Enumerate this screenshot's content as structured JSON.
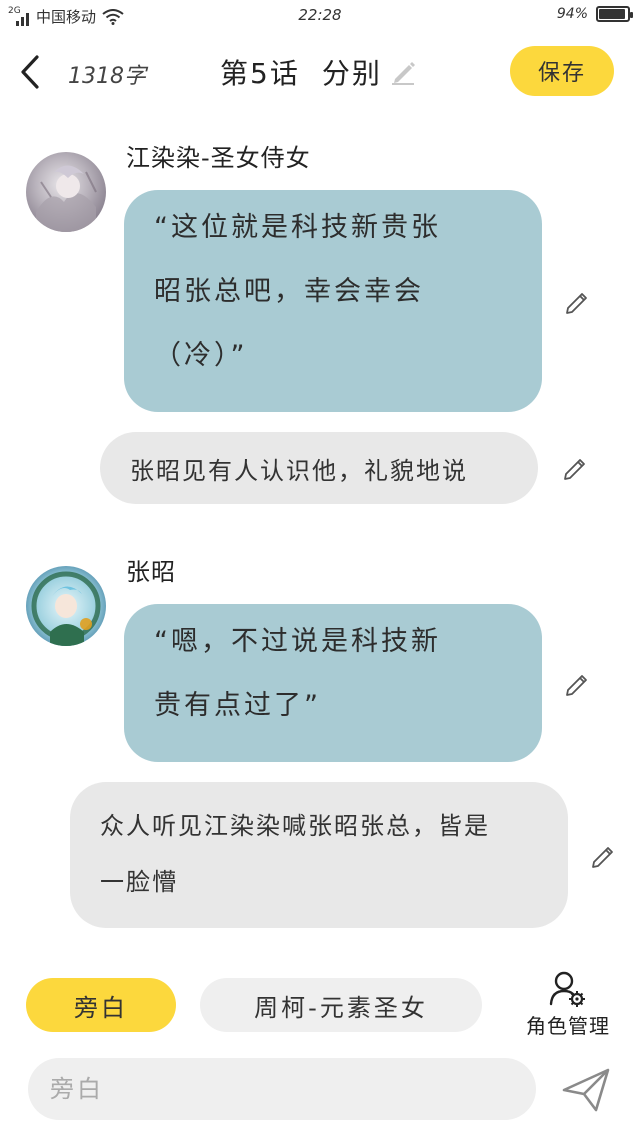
{
  "status_bar": {
    "network_type": "2G",
    "carrier": "中国移动",
    "time": "22:28",
    "battery_text": "94%",
    "battery_level": 0.94
  },
  "nav": {
    "word_count": "1318字",
    "chapter": "第5话",
    "chapter_title": "分别",
    "save_label": "保存"
  },
  "messages": [
    {
      "speaker": "江染染-圣女侍女",
      "lines": [
        "“这位就是科技新贵张",
        "昭张总吧，幸会幸会",
        "（冷）”"
      ]
    },
    {
      "narration": "张昭见有人认识他，礼貌地说"
    },
    {
      "speaker": "张昭",
      "lines": [
        "“嗯，不过说是科技新",
        "贵有点过了”"
      ]
    },
    {
      "narration_lines": [
        "众人听见江染染喊张昭张总，皆是",
        "一脸懵"
      ]
    }
  ],
  "bottom": {
    "role_narration": "旁白",
    "role_character": "周柯-元素圣女",
    "role_manage": "角色管理",
    "input_placeholder": "旁白"
  },
  "colors": {
    "accent_yellow": "#fcd83d",
    "dialog_bubble": "#a9cbd3",
    "narration_bubble": "#e8e8e8"
  },
  "icons": [
    "back-arrow-icon",
    "pencil-icon",
    "edit-icon",
    "role-settings-icon",
    "send-icon",
    "wifi-icon",
    "battery-icon"
  ]
}
